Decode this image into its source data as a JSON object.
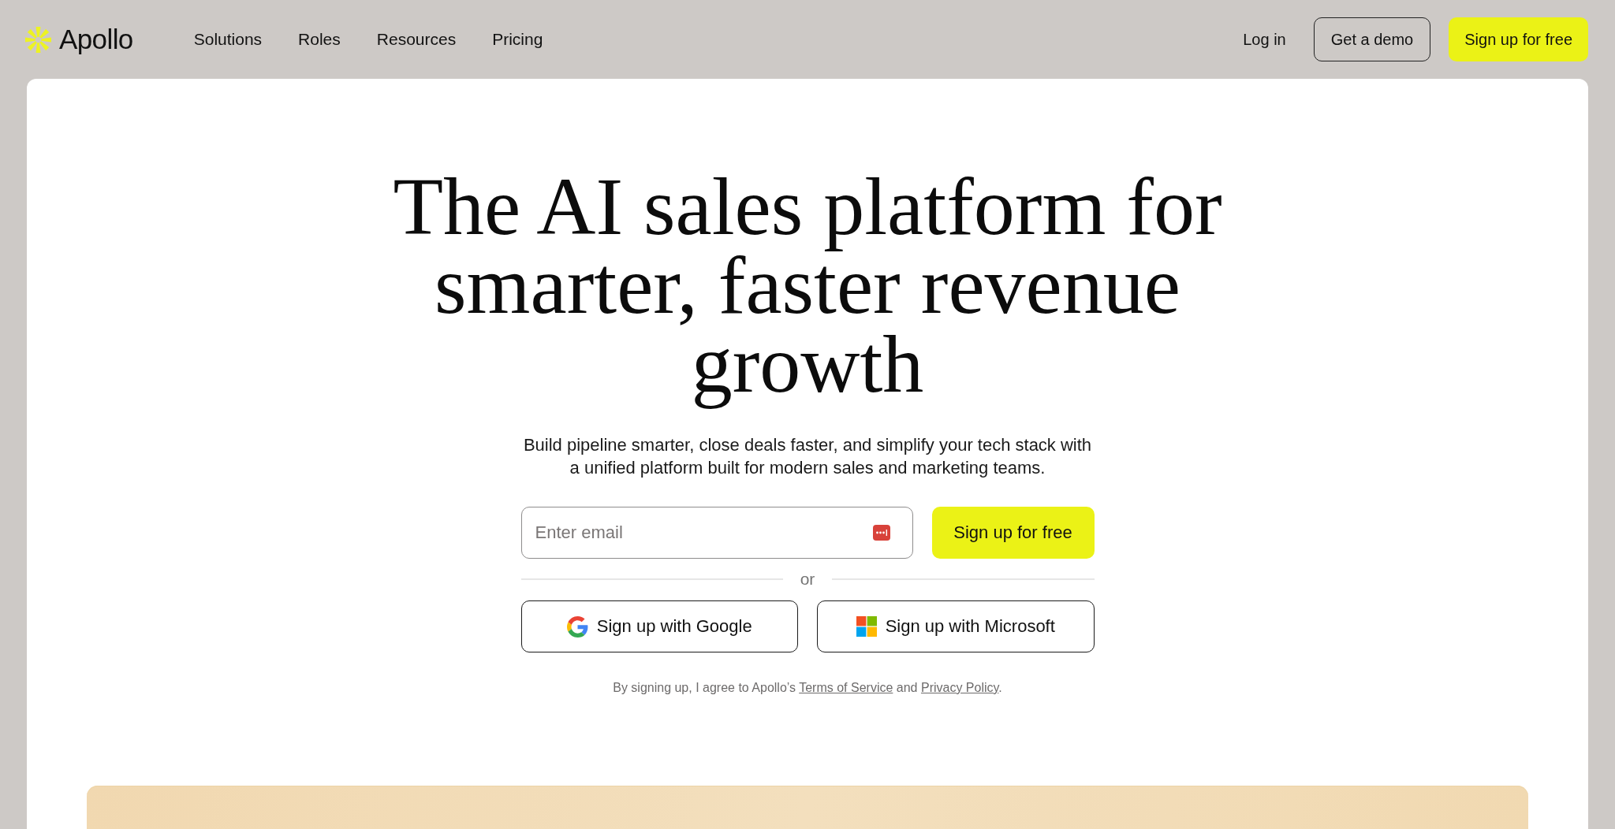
{
  "header": {
    "logo": "Apollo",
    "nav": [
      {
        "label": "Solutions"
      },
      {
        "label": "Roles"
      },
      {
        "label": "Resources"
      },
      {
        "label": "Pricing"
      }
    ],
    "actions": [
      {
        "kind": "link",
        "label": "Log in"
      },
      {
        "kind": "outline",
        "label": "Get a demo"
      },
      {
        "kind": "primary",
        "label": "Sign up for free"
      }
    ]
  },
  "hero": {
    "title_lines": [
      "The AI sales platform for",
      "smarter, faster revenue",
      "growth"
    ],
    "subtitle": "Build pipeline smarter, close deals faster, and simplify your tech stack with a unified platform built for modern sales and marketing teams.",
    "email_field": {
      "placeholder": "Enter email"
    },
    "submit_button": "Sign up for free",
    "divider": "or",
    "sso_buttons": [
      {
        "kind": "google",
        "label": "Sign up with Google"
      },
      {
        "kind": "microsoft",
        "label": "Sign up with Microsoft"
      }
    ],
    "legal": [
      {
        "kind": "text",
        "text": "By signing up, I agree to Apollo’s "
      },
      {
        "kind": "link",
        "text": "Terms of Service"
      },
      {
        "kind": "text",
        "text": " and "
      },
      {
        "kind": "link",
        "text": "Privacy Policy"
      },
      {
        "kind": "text",
        "text": "."
      }
    ]
  }
}
